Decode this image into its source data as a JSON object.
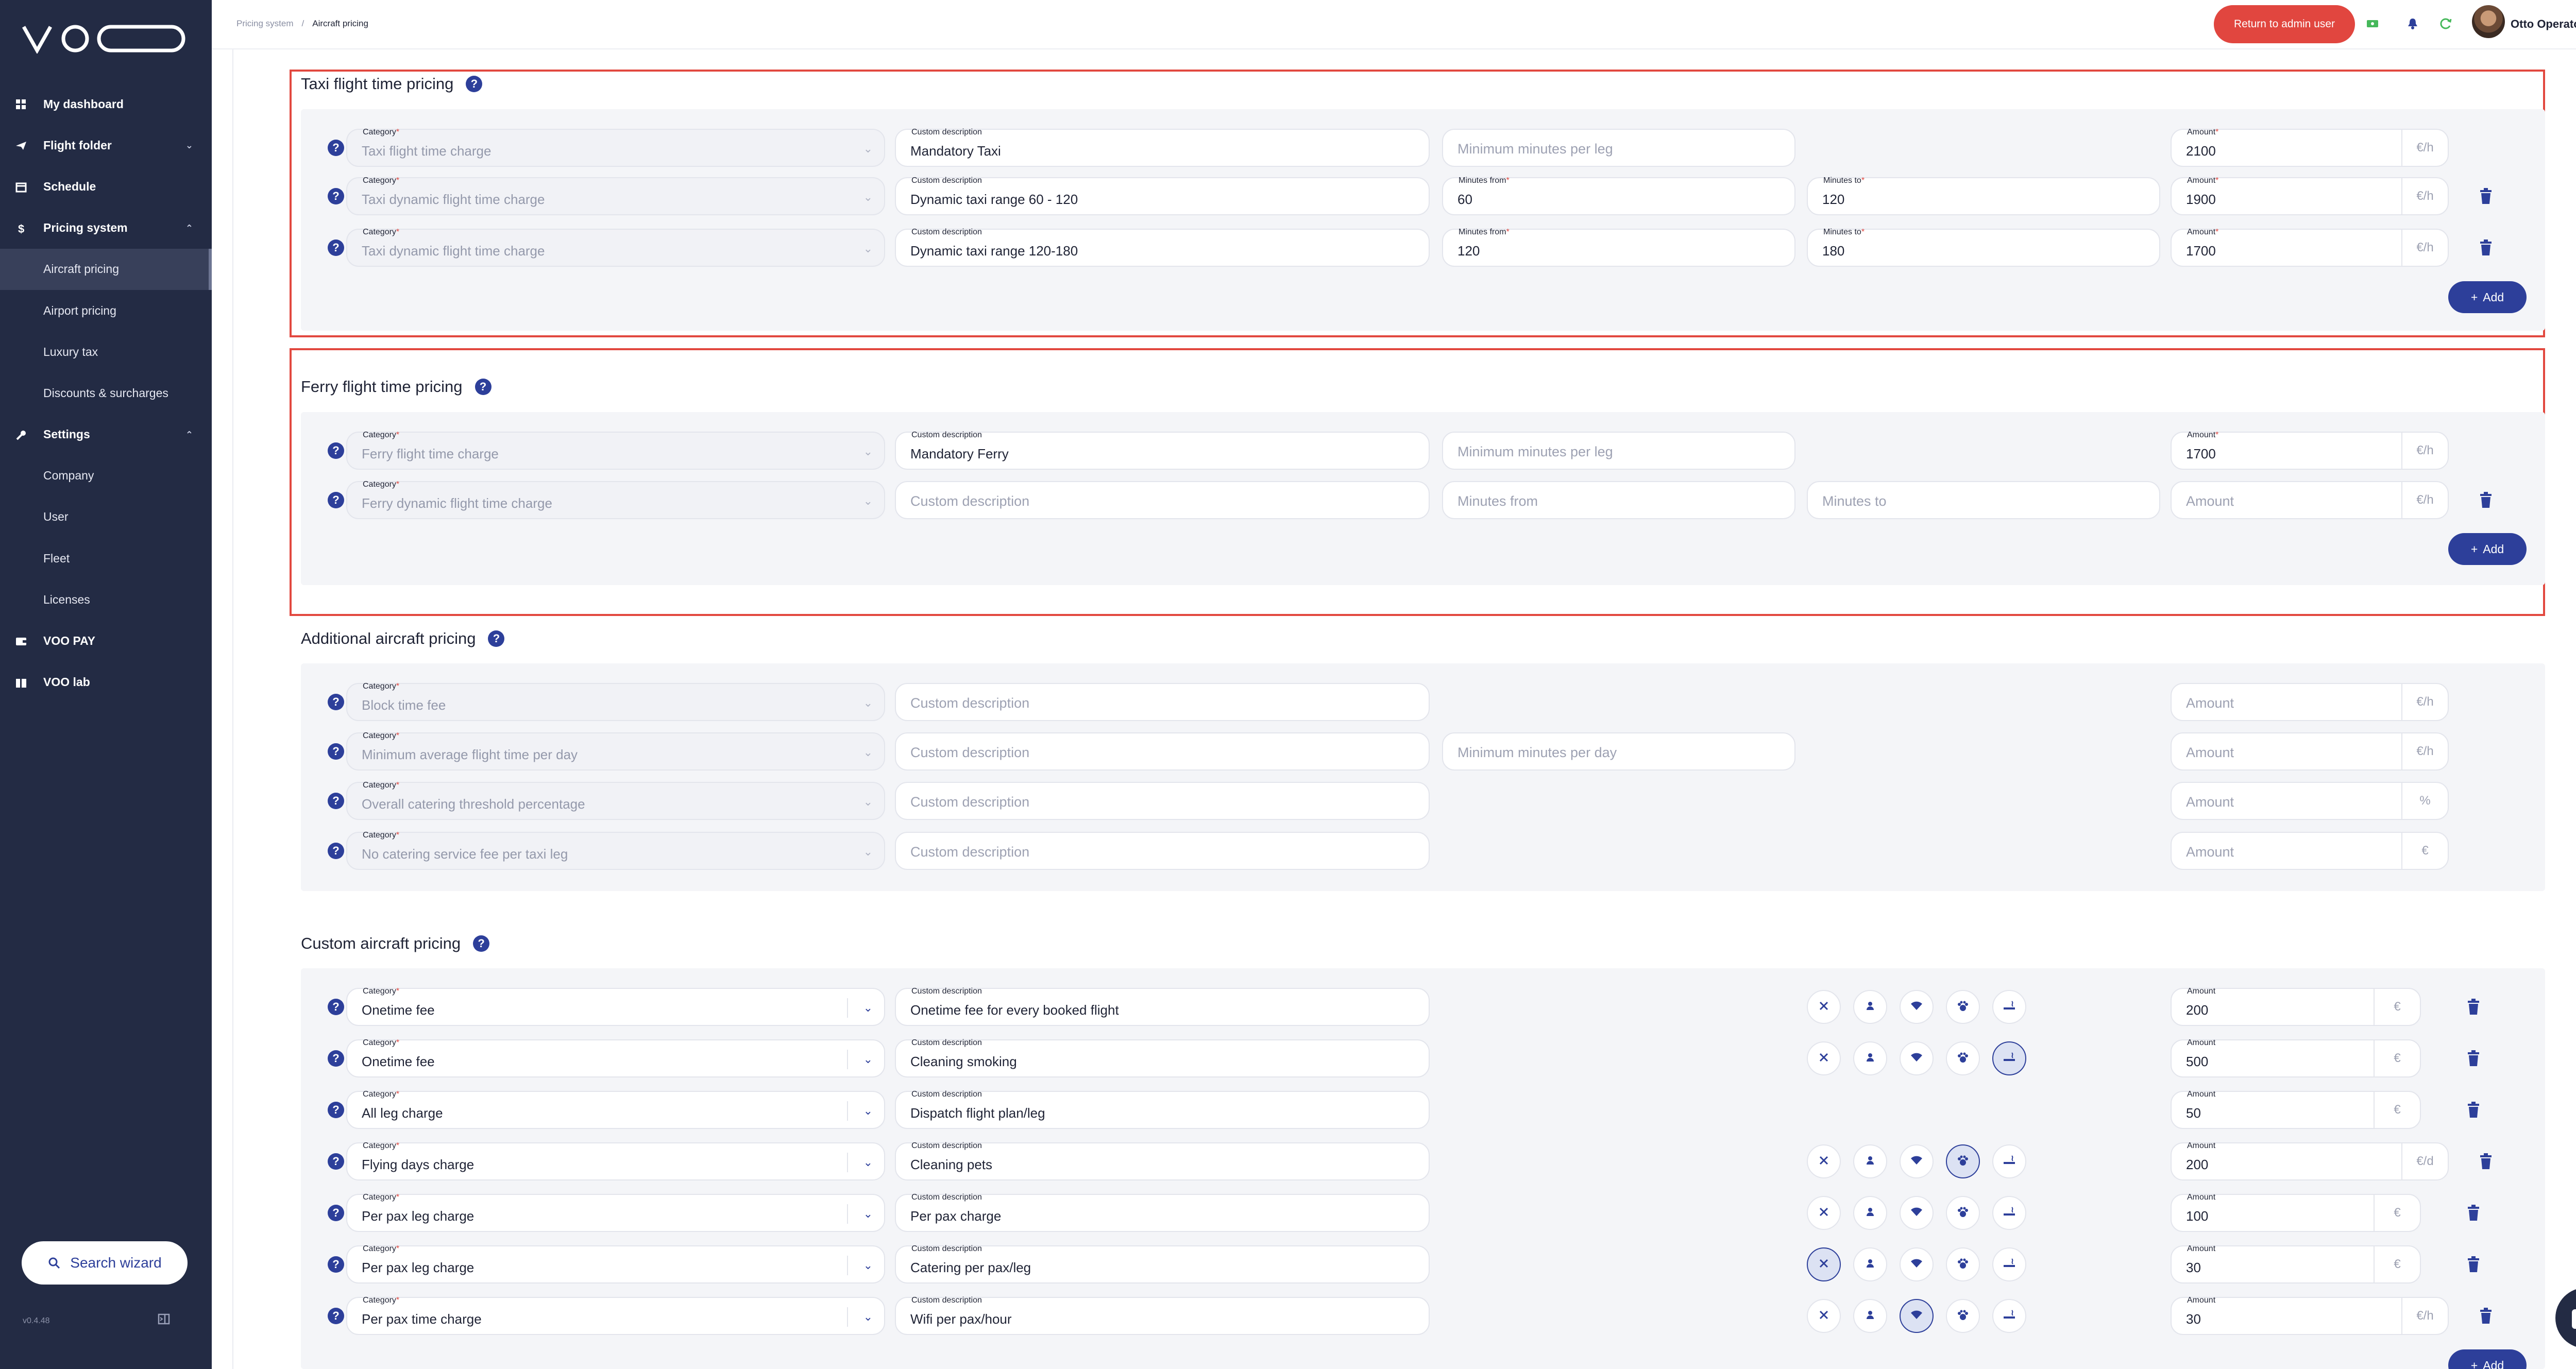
{
  "app": {
    "logo": "VOO",
    "version": "v0.4.48"
  },
  "sidebar": {
    "items": [
      {
        "label": "My dashboard",
        "icon": "dashboard-icon"
      },
      {
        "label": "Flight folder",
        "icon": "plane-icon"
      },
      {
        "label": "Schedule",
        "icon": "calendar-icon"
      },
      {
        "label": "Pricing system",
        "icon": "dollar-icon"
      },
      {
        "label": "Aircraft pricing"
      },
      {
        "label": "Airport pricing"
      },
      {
        "label": "Luxury tax"
      },
      {
        "label": "Discounts & surcharges"
      },
      {
        "label": "Settings",
        "icon": "wrench-icon"
      },
      {
        "label": "Company"
      },
      {
        "label": "User"
      },
      {
        "label": "Fleet"
      },
      {
        "label": "Licenses"
      },
      {
        "label": "VOO PAY",
        "icon": "wallet-icon"
      },
      {
        "label": "VOO lab",
        "icon": "book-icon"
      }
    ],
    "search_wizard": "Search wizard"
  },
  "topbar": {
    "breadcrumb": [
      "Pricing system",
      "Aircraft pricing"
    ],
    "return_btn": "Return to admin user",
    "user_name": "Otto Operator"
  },
  "colors": {
    "accent": "#2d3f9a",
    "sidebar": "#232b44",
    "danger": "#e1463f"
  },
  "sections": {
    "taxi": {
      "title": "Taxi flight time pricing",
      "add": "Add",
      "rows": [
        {
          "category": "Taxi flight time charge",
          "desc": "Mandatory Taxi",
          "min_placeholder": "Minimum minutes per leg",
          "amount": "2100",
          "unit": "€/h"
        },
        {
          "category": "Taxi dynamic flight time charge",
          "desc": "Dynamic taxi range 60 - 120",
          "from": "60",
          "to": "120",
          "amount": "1900",
          "unit": "€/h"
        },
        {
          "category": "Taxi dynamic flight time charge",
          "desc": "Dynamic taxi range 120-180",
          "from": "120",
          "to": "180",
          "amount": "1700",
          "unit": "€/h"
        }
      ]
    },
    "ferry": {
      "title": "Ferry flight time pricing",
      "add": "Add",
      "rows": [
        {
          "category": "Ferry flight time charge",
          "desc": "Mandatory Ferry",
          "min_placeholder": "Minimum minutes per leg",
          "amount": "1700",
          "unit": "€/h"
        },
        {
          "category": "Ferry dynamic flight time charge",
          "desc_placeholder": "Custom description",
          "from_placeholder": "Minutes from",
          "to_placeholder": "Minutes to",
          "amount_placeholder": "Amount",
          "unit": "€/h"
        }
      ]
    },
    "additional": {
      "title": "Additional aircraft pricing",
      "rows": [
        {
          "category": "Block time fee",
          "desc_placeholder": "Custom description",
          "amount_placeholder": "Amount",
          "unit": "€/h"
        },
        {
          "category": "Minimum average flight time per day",
          "desc_placeholder": "Custom description",
          "min_placeholder": "Minimum minutes per day",
          "amount_placeholder": "Amount",
          "unit": "€/h"
        },
        {
          "category": "Overall catering threshold percentage",
          "desc_placeholder": "Custom description",
          "amount_placeholder": "Amount",
          "unit": "%"
        },
        {
          "category": "No catering service fee per taxi leg",
          "desc_placeholder": "Custom description",
          "amount_placeholder": "Amount",
          "unit": "€"
        }
      ]
    },
    "custom": {
      "title": "Custom aircraft pricing",
      "add": "Add",
      "rows": [
        {
          "category": "Onetime fee",
          "desc": "Onetime fee for every booked flight",
          "amount": "200",
          "unit": "€",
          "active": -1
        },
        {
          "category": "Onetime fee",
          "desc": "Cleaning smoking",
          "amount": "500",
          "unit": "€",
          "active": 4
        },
        {
          "category": "All leg charge",
          "desc": "Dispatch flight plan/leg",
          "amount": "50",
          "unit": "€",
          "active": -2
        },
        {
          "category": "Flying days charge",
          "desc": "Cleaning pets",
          "amount": "200",
          "unit": "€/d",
          "active": 3
        },
        {
          "category": "Per pax leg charge",
          "desc": "Per pax charge",
          "amount": "100",
          "unit": "€",
          "active": -1
        },
        {
          "category": "Per pax leg charge",
          "desc": "Catering per pax/leg",
          "amount": "30",
          "unit": "€",
          "active": 0
        },
        {
          "category": "Per pax time charge",
          "desc": "Wifi per pax/hour",
          "amount": "30",
          "unit": "€/h",
          "active": 2
        }
      ]
    }
  },
  "labels": {
    "category": "Category",
    "custom_description": "Custom description",
    "minutes_from": "Minutes from",
    "minutes_to": "Minutes to",
    "amount": "Amount"
  }
}
